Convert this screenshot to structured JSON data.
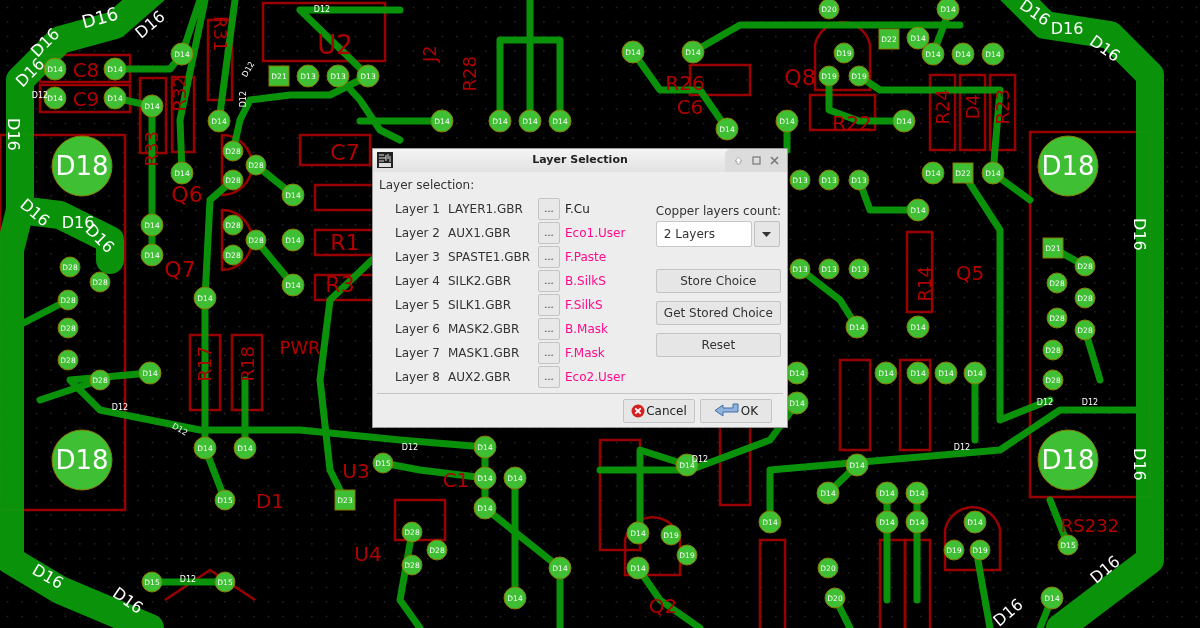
{
  "board": {
    "pads": [
      {
        "label": "D18",
        "kind": "round"
      },
      {
        "label": "D18",
        "kind": "round"
      },
      {
        "label": "D18",
        "kind": "round"
      },
      {
        "label": "D18",
        "kind": "round"
      },
      {
        "label": "D14",
        "kind": "round"
      },
      {
        "label": "D14",
        "kind": "round"
      },
      {
        "label": "D14",
        "kind": "round"
      },
      {
        "label": "D14",
        "kind": "round"
      },
      {
        "label": "D14",
        "kind": "round"
      },
      {
        "label": "D14",
        "kind": "round"
      },
      {
        "label": "D14",
        "kind": "round"
      },
      {
        "label": "D14",
        "kind": "round"
      },
      {
        "label": "D14",
        "kind": "round"
      },
      {
        "label": "D14",
        "kind": "round"
      },
      {
        "label": "D28",
        "kind": "round"
      },
      {
        "label": "D28",
        "kind": "round"
      },
      {
        "label": "D28",
        "kind": "round"
      },
      {
        "label": "D28",
        "kind": "round"
      },
      {
        "label": "D28",
        "kind": "round"
      },
      {
        "label": "D28",
        "kind": "round"
      },
      {
        "label": "D14",
        "kind": "round"
      },
      {
        "label": "D14",
        "kind": "round"
      },
      {
        "label": "D14",
        "kind": "round"
      },
      {
        "label": "D21",
        "kind": "square"
      },
      {
        "label": "D13",
        "kind": "round"
      },
      {
        "label": "D13",
        "kind": "round"
      },
      {
        "label": "D13",
        "kind": "round"
      },
      {
        "label": "D14",
        "kind": "round"
      },
      {
        "label": "D14",
        "kind": "round"
      },
      {
        "label": "D14",
        "kind": "round"
      },
      {
        "label": "D14",
        "kind": "round"
      },
      {
        "label": "D14",
        "kind": "round"
      },
      {
        "label": "D14",
        "kind": "round"
      },
      {
        "label": "D14",
        "kind": "round"
      },
      {
        "label": "D14",
        "kind": "round"
      },
      {
        "label": "D14",
        "kind": "round"
      },
      {
        "label": "D20",
        "kind": "round"
      },
      {
        "label": "D19",
        "kind": "round"
      },
      {
        "label": "D19",
        "kind": "round"
      },
      {
        "label": "D19",
        "kind": "round"
      },
      {
        "label": "D22",
        "kind": "square"
      },
      {
        "label": "D14",
        "kind": "round"
      },
      {
        "label": "D14",
        "kind": "round"
      },
      {
        "label": "D14",
        "kind": "round"
      },
      {
        "label": "D14",
        "kind": "round"
      },
      {
        "label": "D14",
        "kind": "round"
      },
      {
        "label": "D14",
        "kind": "round"
      },
      {
        "label": "D22",
        "kind": "square"
      },
      {
        "label": "D14",
        "kind": "round"
      },
      {
        "label": "D14",
        "kind": "round"
      },
      {
        "label": "D13",
        "kind": "round"
      },
      {
        "label": "D13",
        "kind": "round"
      },
      {
        "label": "D13",
        "kind": "round"
      },
      {
        "label": "D13",
        "kind": "round"
      },
      {
        "label": "D13",
        "kind": "round"
      },
      {
        "label": "D13",
        "kind": "round"
      },
      {
        "label": "D21",
        "kind": "square"
      },
      {
        "label": "D28",
        "kind": "round"
      },
      {
        "label": "D28",
        "kind": "round"
      },
      {
        "label": "D28",
        "kind": "round"
      },
      {
        "label": "D28",
        "kind": "round"
      },
      {
        "label": "D28",
        "kind": "round"
      },
      {
        "label": "D28",
        "kind": "round"
      },
      {
        "label": "D28",
        "kind": "round"
      },
      {
        "label": "D14",
        "kind": "round"
      },
      {
        "label": "D14",
        "kind": "round"
      },
      {
        "label": "D14",
        "kind": "round"
      },
      {
        "label": "D14",
        "kind": "round"
      },
      {
        "label": "D14",
        "kind": "round"
      },
      {
        "label": "D14",
        "kind": "round"
      },
      {
        "label": "D14",
        "kind": "round"
      },
      {
        "label": "D14",
        "kind": "round"
      },
      {
        "label": "D15",
        "kind": "round"
      },
      {
        "label": "D15",
        "kind": "round"
      },
      {
        "label": "D15",
        "kind": "round"
      },
      {
        "label": "D15",
        "kind": "round"
      },
      {
        "label": "D14",
        "kind": "round"
      },
      {
        "label": "D14",
        "kind": "round"
      },
      {
        "label": "D14",
        "kind": "round"
      },
      {
        "label": "D14",
        "kind": "round"
      },
      {
        "label": "D28",
        "kind": "round"
      },
      {
        "label": "D28",
        "kind": "round"
      },
      {
        "label": "D28",
        "kind": "round"
      },
      {
        "label": "D28",
        "kind": "round"
      },
      {
        "label": "D28",
        "kind": "round"
      },
      {
        "label": "D28",
        "kind": "round"
      },
      {
        "label": "D28",
        "kind": "round"
      },
      {
        "label": "D28",
        "kind": "round"
      },
      {
        "label": "D28",
        "kind": "round"
      },
      {
        "label": "D14",
        "kind": "round"
      },
      {
        "label": "D14",
        "kind": "round"
      },
      {
        "label": "D14",
        "kind": "round"
      },
      {
        "label": "D14",
        "kind": "round"
      },
      {
        "label": "D14",
        "kind": "round"
      },
      {
        "label": "D14",
        "kind": "round"
      },
      {
        "label": "D14",
        "kind": "round"
      },
      {
        "label": "D14",
        "kind": "round"
      },
      {
        "label": "D19",
        "kind": "round"
      },
      {
        "label": "D19",
        "kind": "round"
      },
      {
        "label": "D14",
        "kind": "round"
      },
      {
        "label": "D14",
        "kind": "round"
      },
      {
        "label": "D14",
        "kind": "round"
      },
      {
        "label": "D14",
        "kind": "round"
      },
      {
        "label": "D14",
        "kind": "round"
      },
      {
        "label": "D14",
        "kind": "round"
      },
      {
        "label": "D14",
        "kind": "round"
      },
      {
        "label": "D14",
        "kind": "round"
      },
      {
        "label": "D20",
        "kind": "round"
      },
      {
        "label": "D20",
        "kind": "round"
      },
      {
        "label": "D19",
        "kind": "round"
      },
      {
        "label": "D19",
        "kind": "round"
      },
      {
        "label": "D14",
        "kind": "round"
      },
      {
        "label": "D14",
        "kind": "round"
      },
      {
        "label": "D23",
        "kind": "square"
      },
      {
        "label": "D15",
        "kind": "round"
      }
    ],
    "silkscreen": [
      {
        "text": "U2"
      },
      {
        "text": "C8"
      },
      {
        "text": "C9"
      },
      {
        "text": "R31"
      },
      {
        "text": "R32"
      },
      {
        "text": "R33"
      },
      {
        "text": "Q6"
      },
      {
        "text": "C7"
      },
      {
        "text": "R1"
      },
      {
        "text": "Q7"
      },
      {
        "text": "R3"
      },
      {
        "text": "R17"
      },
      {
        "text": "R18"
      },
      {
        "text": "PWR"
      },
      {
        "text": "U3"
      },
      {
        "text": "D1"
      },
      {
        "text": "C1"
      },
      {
        "text": "U4"
      },
      {
        "text": "Q2"
      },
      {
        "text": "R26"
      },
      {
        "text": "C6"
      },
      {
        "text": "Q8"
      },
      {
        "text": "R22"
      },
      {
        "text": "R24"
      },
      {
        "text": "D4"
      },
      {
        "text": "R23"
      },
      {
        "text": "Q5"
      },
      {
        "text": "R14"
      },
      {
        "text": "RS232"
      },
      {
        "text": "J2"
      },
      {
        "text": "R28"
      }
    ],
    "track_labels": [
      {
        "text": "D16"
      },
      {
        "text": "D16"
      },
      {
        "text": "D16"
      },
      {
        "text": "D16"
      },
      {
        "text": "D16"
      },
      {
        "text": "D16"
      },
      {
        "text": "D16"
      },
      {
        "text": "D16"
      },
      {
        "text": "D16"
      },
      {
        "text": "D16"
      },
      {
        "text": "D16"
      },
      {
        "text": "D16"
      },
      {
        "text": "D16"
      },
      {
        "text": "D16"
      },
      {
        "text": "D16"
      },
      {
        "text": "D16"
      },
      {
        "text": "D16"
      },
      {
        "text": "D12"
      },
      {
        "text": "D12"
      },
      {
        "text": "D12"
      },
      {
        "text": "D12"
      },
      {
        "text": "D12"
      },
      {
        "text": "D12"
      },
      {
        "text": "D12"
      },
      {
        "text": "D12"
      },
      {
        "text": "D12"
      },
      {
        "text": "D12"
      },
      {
        "text": "D12"
      },
      {
        "text": "D12"
      }
    ]
  },
  "dialog": {
    "title": "Layer Selection",
    "heading": "Layer selection:",
    "rows": [
      {
        "layer": "Layer 1",
        "file": "LAYER1.GBR",
        "browse": "...",
        "target": "F.Cu",
        "color": "#222222"
      },
      {
        "layer": "Layer 2",
        "file": "AUX1.GBR",
        "browse": "...",
        "target": "Eco1.User",
        "color": "#ff0a8c"
      },
      {
        "layer": "Layer 3",
        "file": "SPASTE1.GBR",
        "browse": "...",
        "target": "F.Paste",
        "color": "#ff0a8c"
      },
      {
        "layer": "Layer 4",
        "file": "SILK2.GBR",
        "browse": "...",
        "target": "B.SilkS",
        "color": "#ff0a8c"
      },
      {
        "layer": "Layer 5",
        "file": "SILK1.GBR",
        "browse": "...",
        "target": "F.SilkS",
        "color": "#ff0a8c"
      },
      {
        "layer": "Layer 6",
        "file": "MASK2.GBR",
        "browse": "...",
        "target": "B.Mask",
        "color": "#ff0a8c"
      },
      {
        "layer": "Layer 7",
        "file": "MASK1.GBR",
        "browse": "...",
        "target": "F.Mask",
        "color": "#ff0a8c"
      },
      {
        "layer": "Layer 8",
        "file": "AUX2.GBR",
        "browse": "...",
        "target": "Eco2.User",
        "color": "#ff0a8c"
      }
    ],
    "copper_count": {
      "label": "Copper layers count:",
      "value": "2 Layers"
    },
    "buttons": [
      {
        "label": "Store Choice"
      },
      {
        "label": "Get Stored Choice"
      },
      {
        "label": "Reset"
      }
    ],
    "footer": [
      {
        "label": "Cancel",
        "kind": "cancel"
      },
      {
        "label": "OK",
        "kind": "ok"
      }
    ]
  }
}
